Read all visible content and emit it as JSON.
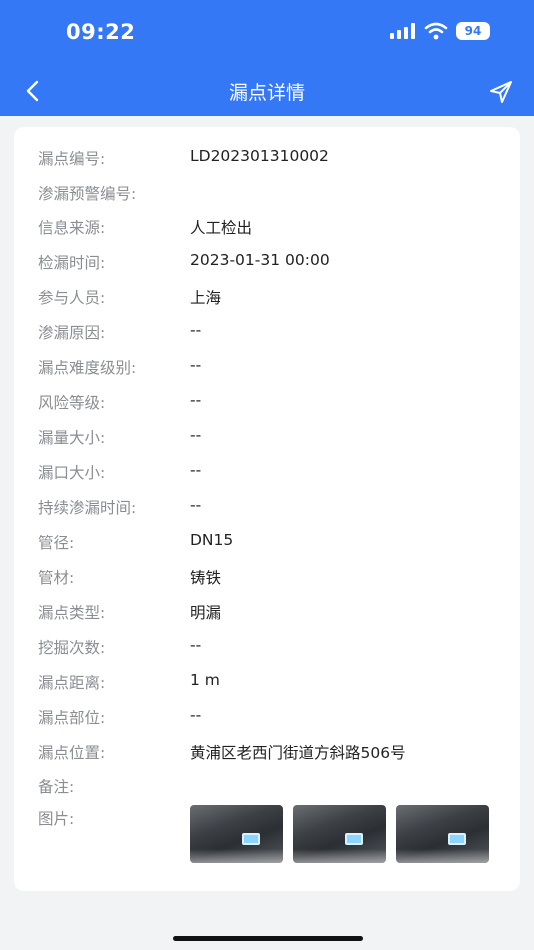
{
  "status_bar": {
    "time": "09:22",
    "battery": "94",
    "icons": [
      "signal-icon",
      "wifi-icon",
      "battery-icon"
    ]
  },
  "nav": {
    "title": "漏点详情",
    "back_icon": "chevron-left-icon",
    "send_icon": "send-icon"
  },
  "colors": {
    "header": "#3478f6",
    "background": "#f2f3f5",
    "label": "#8a8d93",
    "value": "#222222"
  },
  "details": [
    {
      "label": "漏点编号:",
      "value": "LD202301310002"
    },
    {
      "label": "渗漏预警编号:",
      "value": ""
    },
    {
      "label": "信息来源:",
      "value": "人工检出"
    },
    {
      "label": "检漏时间:",
      "value": "2023-01-31 00:00"
    },
    {
      "label": "参与人员:",
      "value": "上海"
    },
    {
      "label": "渗漏原因:",
      "value": "--"
    },
    {
      "label": "漏点难度级别:",
      "value": "--"
    },
    {
      "label": "风险等级:",
      "value": "--"
    },
    {
      "label": "漏量大小:",
      "value": "--"
    },
    {
      "label": "漏口大小:",
      "value": "--"
    },
    {
      "label": "持续渗漏时间:",
      "value": "--"
    },
    {
      "label": "管径:",
      "value": "DN15"
    },
    {
      "label": "管材:",
      "value": "铸铁"
    },
    {
      "label": "漏点类型:",
      "value": "明漏"
    },
    {
      "label": "挖掘次数:",
      "value": "--"
    },
    {
      "label": "漏点距离:",
      "value": "1 m"
    },
    {
      "label": "漏点部位:",
      "value": "--"
    },
    {
      "label": "漏点位置:",
      "value": "黄浦区老西门街道方斜路506号"
    },
    {
      "label": "备注:",
      "value": ""
    },
    {
      "label": "图片:",
      "value": ""
    }
  ],
  "photos_count": 3
}
